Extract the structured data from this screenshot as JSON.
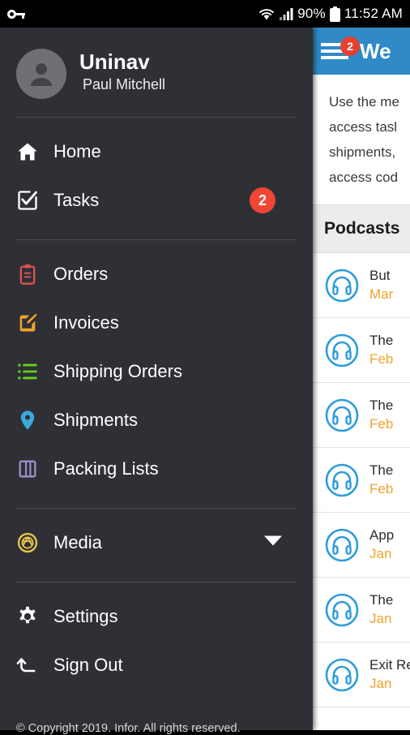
{
  "status_bar": {
    "left_icon": "key-icon",
    "wifi_icon": "wifi-icon",
    "signal_icon": "signal-bars-icon",
    "battery_percent": "90%",
    "battery_icon": "battery-icon",
    "time": "11:52 AM"
  },
  "drawer": {
    "title": "Uninav",
    "user": "Paul Mitchell",
    "avatar_icon": "person-avatar-icon",
    "items": [
      {
        "label": "Home",
        "icon": "home-icon",
        "color": "#ffffff",
        "badge": null
      },
      {
        "label": "Tasks",
        "icon": "checkbox-check-icon",
        "color": "#ffffff",
        "badge": "2"
      },
      {
        "label": "Orders",
        "icon": "clipboard-icon",
        "color": "#d9534f",
        "badge": null
      },
      {
        "label": "Invoices",
        "icon": "edit-square-icon",
        "color": "#f0a32a",
        "badge": null
      },
      {
        "label": "Shipping Orders",
        "icon": "list-ul-icon",
        "color": "#63d419",
        "badge": null
      },
      {
        "label": "Shipments",
        "icon": "map-pin-icon",
        "color": "#3aa9dd",
        "badge": null
      },
      {
        "label": "Packing Lists",
        "icon": "columns-icon",
        "color": "#9e8fc7",
        "badge": null
      },
      {
        "label": "Media",
        "icon": "aperture-icon",
        "color": "#e8c54a",
        "badge": null,
        "expandable": true,
        "chevron_icon": "chevron-down-icon"
      },
      {
        "label": "Settings",
        "icon": "gear-icon",
        "color": "#ffffff",
        "badge": null
      },
      {
        "label": "Sign Out",
        "icon": "sign-out-arrow-icon",
        "color": "#ffffff",
        "badge": null
      }
    ],
    "copyright": "© Copyright 2019. Infor. All rights reserved."
  },
  "main": {
    "app_bar": {
      "menu_icon": "hamburger-menu-icon",
      "badge": "2",
      "title": "We"
    },
    "welcome_lines": [
      "Use the me",
      "access tasl",
      "shipments,",
      "access cod"
    ],
    "section_header": "Podcasts",
    "podcasts": [
      {
        "icon": "headphones-icon",
        "title": "But",
        "date": "Mar"
      },
      {
        "icon": "headphones-icon",
        "title": "The",
        "date": "Feb"
      },
      {
        "icon": "headphones-icon",
        "title": "The",
        "date": "Feb"
      },
      {
        "icon": "headphones-icon",
        "title": "The",
        "date": "Feb"
      },
      {
        "icon": "headphones-icon",
        "title": "App",
        "date": "Jan"
      },
      {
        "icon": "headphones-icon",
        "title": "The",
        "date": "Jan"
      },
      {
        "icon": "headphones-icon",
        "title": "Exit Rev",
        "date": "Jan"
      }
    ]
  },
  "colors": {
    "drawer_bg": "#2e3036",
    "app_bar": "#2f8ac6",
    "badge_red": "#ee4535",
    "accent_orange": "#f0a32a",
    "podcast_icon_blue": "#2d9cdb",
    "section_bg": "#ececec"
  }
}
